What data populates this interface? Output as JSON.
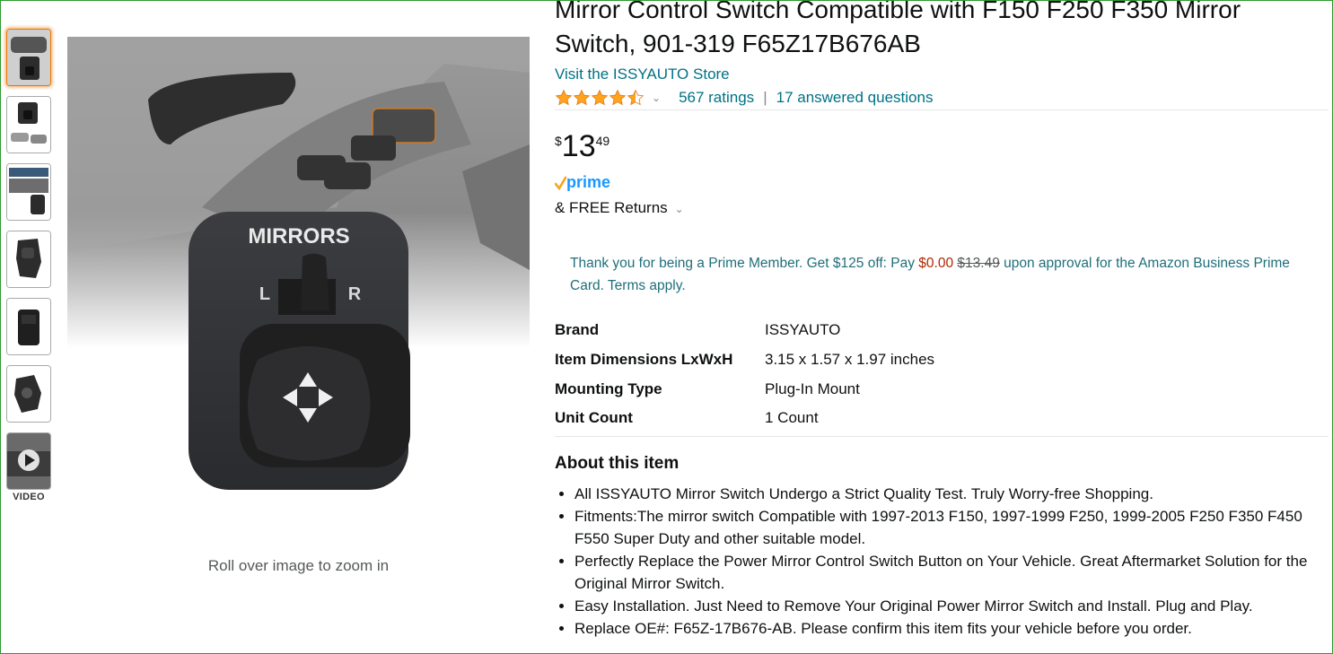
{
  "product": {
    "title": "Mirror Control Switch Compatible with F150 F250 F350 Mirror Switch, 901-319 F65Z17B676AB",
    "store_link": "Visit the ISSYAUTO Store",
    "rating_stars": 4.5,
    "ratings_count": "567 ratings",
    "answered_questions": "17 answered questions",
    "price": {
      "symbol": "$",
      "whole": "13",
      "fraction": "49"
    },
    "prime_label": "prime",
    "returns": "& FREE Returns",
    "promo": {
      "prefix": "Thank you for being a Prime Member. Get $125 off: Pay",
      "pay_amount": "$0.00",
      "original": "$13.49",
      "suffix": "upon approval for the Amazon Business Prime Card. Terms apply."
    },
    "image_caption": "MIRRORS",
    "image_left": "L",
    "image_right": "R"
  },
  "gallery": {
    "zoom_hint": "Roll over image to zoom in",
    "video_label": "VIDEO",
    "thumbnail_count": 7
  },
  "specs": [
    {
      "key": "Brand",
      "value": "ISSYAUTO"
    },
    {
      "key": "Item Dimensions LxWxH",
      "value": "3.15 x 1.57 x 1.97 inches"
    },
    {
      "key": "Mounting Type",
      "value": "Plug-In Mount"
    },
    {
      "key": "Unit Count",
      "value": "1 Count"
    }
  ],
  "about": {
    "heading": "About this item",
    "bullets": [
      "All ISSYAUTO Mirror Switch Undergo a Strict Quality Test. Truly Worry-free Shopping.",
      "Fitments:The mirror switch Compatible with 1997-2013 F150, 1997-1999 F250, 1999-2005 F250 F350 F450 F550 Super Duty and other suitable model.",
      "Perfectly Replace the Power Mirror Control Switch Button on Your Vehicle. Great Aftermarket Solution for the Original Mirror Switch.",
      "Easy Installation. Just Need to Remove Your Original Power Mirror Switch and Install. Plug and Play.",
      "Replace OE#: F65Z-17B676-AB. Please confirm this item fits your vehicle before you order."
    ]
  },
  "colors": {
    "link": "#007185",
    "accent": "#e77600",
    "star": "#ffa41c",
    "price_red": "#b12704"
  }
}
